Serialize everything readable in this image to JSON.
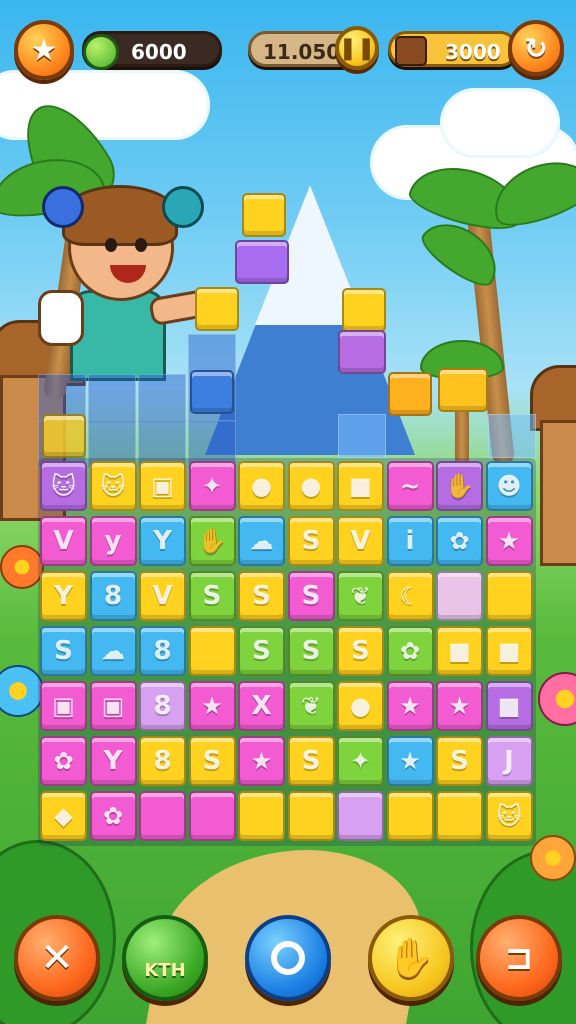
{
  "hud": {
    "score_left": "6000",
    "score_mid": "11.050",
    "score_right": "3000"
  },
  "bottom_bar": {
    "green_button_label": "KTH"
  },
  "board": {
    "rows": [
      [
        "cat",
        "cat",
        "cube",
        "beast",
        "apple",
        "apple",
        "box",
        "worm",
        "hand",
        "alien"
      ],
      [
        "V",
        "y",
        "Y",
        "hand",
        "cloud",
        "S",
        "V",
        "i",
        "fish",
        "star"
      ],
      [
        "Y",
        "8",
        "V",
        "S",
        "S",
        "S",
        "leaf",
        "banana",
        "",
        ""
      ],
      [
        "S",
        "cloud",
        "8",
        "",
        "S",
        "S",
        "S",
        "flower",
        "box",
        "box"
      ],
      [
        "cube",
        "cube",
        "8",
        "star",
        "X",
        "leaf",
        "apple",
        "star",
        "star",
        "box"
      ],
      [
        "fish",
        "Y",
        "8",
        "S",
        "star",
        "S",
        "bird",
        "star",
        "S",
        "J"
      ],
      [
        "chip",
        "flower",
        "",
        "",
        "",
        "",
        "",
        "",
        "",
        "cat"
      ]
    ]
  },
  "colors": {
    "pink": "#f25bd1",
    "yellow": "#ffd21f",
    "blue": "#43b8f1",
    "green": "#7fd33d",
    "purple": "#b66de3",
    "lilac": "#d7a0f0",
    "orange": "#ff8a1f"
  },
  "icons": {
    "top_left": "star-icon",
    "gem": "gem-icon",
    "pause": "pause-icon",
    "chest": "chest-icon",
    "refresh": "refresh-icon",
    "close": "close-icon",
    "shuffle": "shuffle-icon",
    "hand": "hand-icon",
    "exit": "exit-icon"
  }
}
